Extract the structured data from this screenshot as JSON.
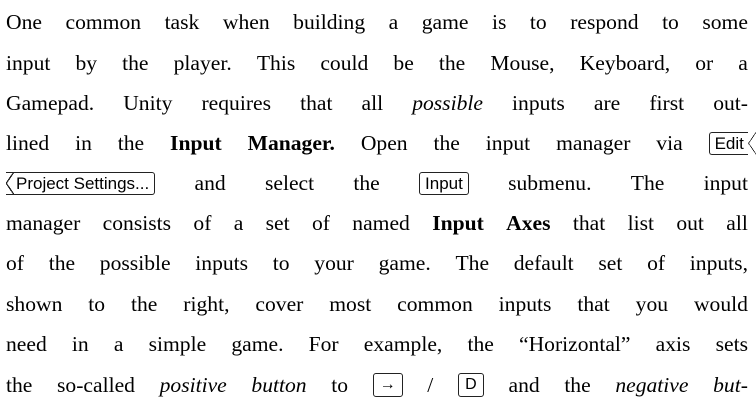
{
  "paragraph": {
    "l1": [
      "One",
      "common",
      "task",
      "when",
      "building",
      "a",
      "game",
      "is",
      "to",
      "respond",
      "to",
      "some"
    ],
    "l2": [
      "input",
      "by",
      "the",
      "player.",
      "This",
      "could",
      "be",
      "the",
      "Mouse,",
      "Keyboard,",
      "or",
      "a"
    ],
    "l3a": [
      "Gamepad.",
      "Unity",
      "requires",
      "that",
      "all"
    ],
    "l3_possible": "possible",
    "l3b": [
      "inputs",
      "are",
      "first",
      "out-"
    ],
    "l4a": [
      "lined",
      "in",
      "the"
    ],
    "l4_bold": [
      "Input",
      "Manager."
    ],
    "l4b": [
      "Open",
      "the",
      "input",
      "manager",
      "via"
    ],
    "l4_key": "Edit",
    "l5_key1": "Project Settings...",
    "l5a": [
      "and",
      "select",
      "the"
    ],
    "l5_key2": "Input",
    "l5b": [
      "submenu.",
      "The",
      "input"
    ],
    "l6a": [
      "manager",
      "consists",
      "of",
      "a",
      "set",
      "of",
      "named"
    ],
    "l6_bold": [
      "Input",
      "Axes"
    ],
    "l6b": [
      "that",
      "list",
      "out",
      "all"
    ],
    "l7": [
      "of",
      "the",
      "possible",
      "inputs",
      "to",
      "your",
      "game.",
      "The",
      "default",
      "set",
      "of",
      "inputs,"
    ],
    "l8": [
      "shown",
      "to",
      "the",
      "right,",
      "cover",
      "most",
      "common",
      "inputs",
      "that",
      "you",
      "would"
    ],
    "l9": [
      "need",
      "in",
      "a",
      "simple",
      "game.",
      "For",
      "example,",
      "the",
      "“Horizontal”",
      "axis",
      "sets"
    ],
    "l10a": [
      "the",
      "so-called"
    ],
    "l10_italic": [
      "positive",
      "button"
    ],
    "l10b": "to",
    "l10_key_arrow": "→",
    "l10_slash": "/",
    "l10_key_d": "D",
    "l10c": [
      "and",
      "the"
    ],
    "l10_italic2": [
      "negative",
      "but-"
    ]
  }
}
